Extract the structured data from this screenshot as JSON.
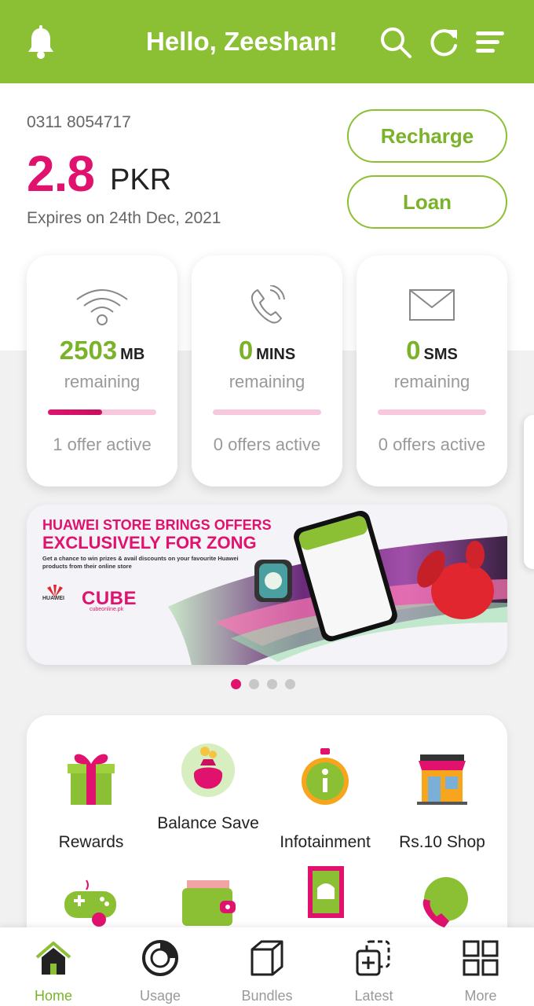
{
  "header": {
    "title": "Hello, Zeeshan!"
  },
  "account": {
    "msisdn": "0311 8054717",
    "balance": "2.8",
    "currency": "PKR",
    "expiry": "Expires on 24th Dec, 2021",
    "recharge_label": "Recharge",
    "loan_label": "Loan"
  },
  "usage_cards": [
    {
      "value": "2503",
      "unit": "MB",
      "remaining": "remaining",
      "offers": "1 offer active",
      "progress": 0.5
    },
    {
      "value": "0",
      "unit": "MINS",
      "remaining": "remaining",
      "offers": "0 offers active",
      "progress": 0
    },
    {
      "value": "0",
      "unit": "SMS",
      "remaining": "remaining",
      "offers": "0 offers active",
      "progress": 0
    }
  ],
  "banner": {
    "line1": "HUAWEI STORE BRINGS OFFERS",
    "line2": "EXCLUSIVELY FOR ZONG",
    "sub": "Get a chance to win prizes & avail discounts on your favourite Huawei products from their online store",
    "huawei": "HUAWEI",
    "cube": "CUBE",
    "cube_url": "cubeonline.pk",
    "pages": 4,
    "active_page": 1
  },
  "services": [
    {
      "label": "Rewards"
    },
    {
      "label": "Balance Save"
    },
    {
      "label": "Infotainment"
    },
    {
      "label": "Rs.10 Shop"
    }
  ],
  "nav": [
    {
      "label": "Home",
      "active": true
    },
    {
      "label": "Usage"
    },
    {
      "label": "Bundles"
    },
    {
      "label": "Latest"
    },
    {
      "label": "More"
    }
  ],
  "colors": {
    "brand_green": "#8cc034",
    "brand_pink": "#e0126d"
  }
}
